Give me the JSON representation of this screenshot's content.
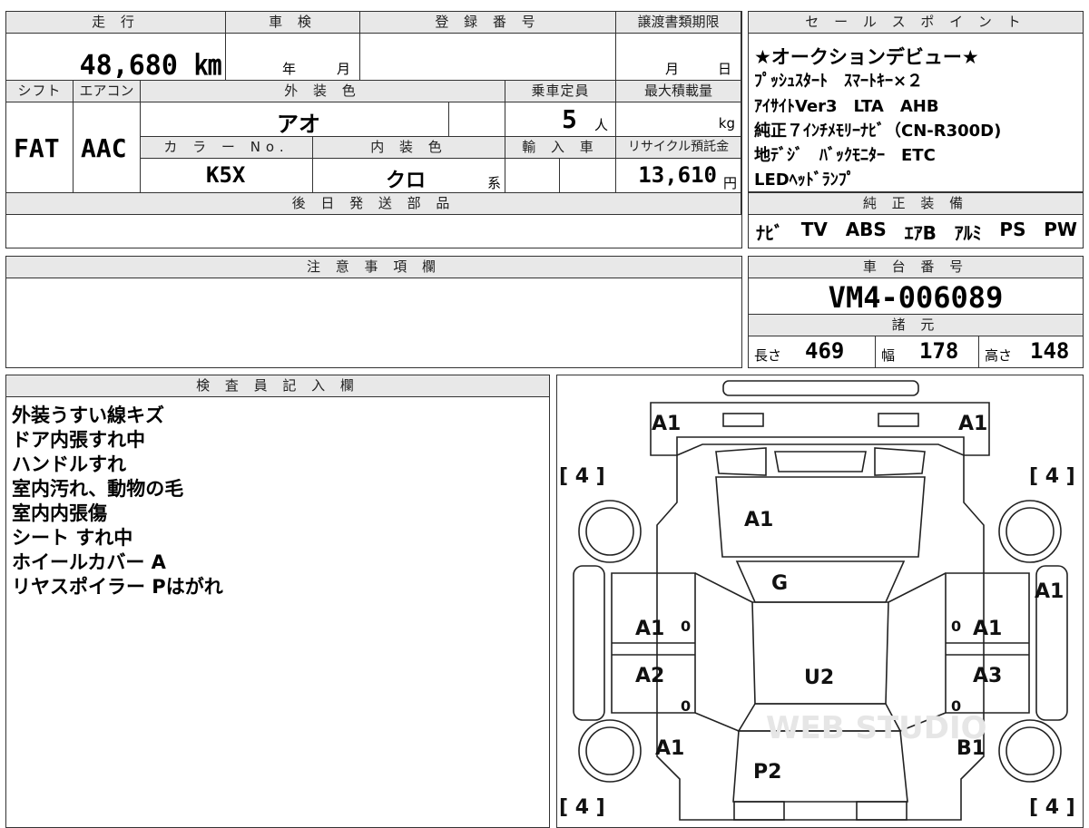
{
  "top_info": {
    "mileage_header": "走 行",
    "mileage": "48,680 ㎞",
    "shaken_header": "車 検",
    "shaken_year_unit": "年",
    "shaken_month_unit": "月",
    "reg_header": "登 録 番 号",
    "transfer_header": "譲渡書類期限",
    "transfer_month_unit": "月",
    "transfer_day_unit": "日",
    "shift_header": "シフト",
    "shift": "FAT",
    "ac_header": "エアコン",
    "ac": "AAC",
    "exterior_header": "外 装 色",
    "exterior": "アオ",
    "capacity_header": "乗車定員",
    "capacity": "5",
    "capacity_unit": "人",
    "load_header": "最大積載量",
    "load_unit": "kg",
    "color_no_header": "カ ラ ー No.",
    "color_no": "K5X",
    "interior_header": "内 装 色",
    "interior": "クロ",
    "interior_suffix": "系",
    "import_header": "輸 入 車",
    "recycle_header": "リサイクル預託金",
    "recycle": "13,610",
    "recycle_unit": "円",
    "later_parts_header": "後 日 発 送 部 品"
  },
  "sales_points": {
    "header": "セ ー ル ス ポ イ ン ト",
    "lines": [
      "★オークションデビュー★",
      "ﾌﾟｯｼｭｽﾀｰﾄ　ｽﾏｰﾄｷｰ×２",
      "ｱｲｻｲﾄVer3　LTA　AHB",
      "純正７ｲﾝﾁﾒﾓﾘｰﾅﾋﾞ（CN-R300D)",
      "地ﾃﾞｼﾞ　ﾊﾞｯｸﾓﾆﾀｰ　ETC",
      "LEDﾍｯﾄﾞﾗﾝﾌﾟ"
    ]
  },
  "equipment": {
    "header": "純 正 装 備",
    "items": [
      "ﾅﾋﾞ",
      "TV",
      "ABS",
      "ｴｱB",
      "ｱﾙﾐ",
      "PS",
      "PW"
    ]
  },
  "caution": {
    "header": "注 意 事 項 欄"
  },
  "chassis": {
    "header": "車 台 番 号",
    "number": "VM4-006089",
    "specs_header": "諸 元",
    "length_label": "長さ",
    "length": "469",
    "width_label": "幅",
    "width": "178",
    "height_label": "高さ",
    "height": "148"
  },
  "inspector": {
    "header": "検 査 員 記 入 欄",
    "notes": [
      "外装うすい線キズ",
      "ドア内張すれ中",
      "ハンドルすれ",
      "室内汚れ、動物の毛",
      "室内内張傷",
      "シート すれ中",
      "ホイールカバー A",
      "リヤスポイラー Pはがれ"
    ]
  },
  "diagram": {
    "tire_front_left": "[ 4 ]",
    "tire_front_right": "[ 4 ]",
    "tire_rear_left": "[ 4 ]",
    "tire_rear_right": "[ 4 ]",
    "bumper_front_left": "A1",
    "bumper_front_right": "A1",
    "hood": "A1",
    "windshield": "G",
    "side_right_fender": "A1",
    "door_front_left": "A1",
    "door_front_right": "A1",
    "door_rear_left": "A2",
    "door_rear_right": "A3",
    "roof": "U2",
    "quarter_left": "A1",
    "quarter_right": "B1",
    "trunk": "P2",
    "pillar_mark": "0",
    "watermark": "WEB STUDIO"
  }
}
